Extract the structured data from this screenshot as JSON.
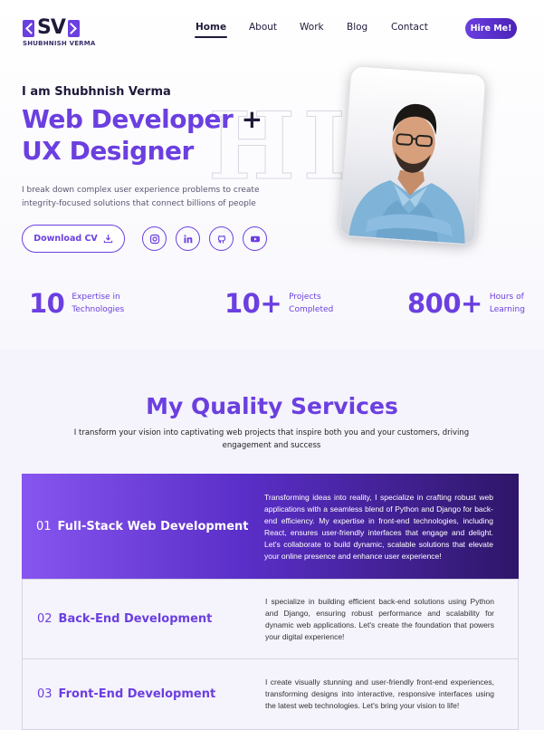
{
  "brand": {
    "logo_text": "SV",
    "name": "SHUBHNISH VERMA"
  },
  "nav": {
    "items": [
      "Home",
      "About",
      "Work",
      "Blog",
      "Contact"
    ],
    "active": "Home",
    "cta": "Hire Me!"
  },
  "hero": {
    "greeting": "I am Shubhnish Verma",
    "headline_line1": "Web Developer",
    "headline_plus": " +",
    "headline_line2": "UX Designer",
    "watermark": "HI",
    "intro": "I break down complex user experience problems to create integrity-focused solutions that connect billions of people",
    "download_label": "Download CV",
    "socials": [
      "instagram-icon",
      "linkedin-icon",
      "github-icon",
      "youtube-icon"
    ]
  },
  "stats": [
    {
      "value": "10",
      "label_line1": "Expertise in",
      "label_line2": "Technologies"
    },
    {
      "value": "10+",
      "label_line1": "Projects",
      "label_line2": "Completed"
    },
    {
      "value": "800+",
      "label_line1": "Hours of",
      "label_line2": "Learning"
    }
  ],
  "services": {
    "title": "My Quality Services",
    "subtitle": "I transform your vision into captivating web projects that inspire both you and your customers, driving engagement and success",
    "items": [
      {
        "number": "01",
        "title": "Full-Stack Web Development",
        "description": "Transforming ideas into reality, I specialize in crafting robust web applications with a seamless blend of Python and Django for back-end efficiency. My expertise in front-end technologies, including React, ensures user-friendly interfaces that engage and delight. Let's collaborate to build dynamic, scalable solutions that elevate your online presence and enhance user experience!"
      },
      {
        "number": "02",
        "title": "Back-End Development",
        "description": "I specialize in building efficient back-end solutions using Python and Django, ensuring robust performance and scalability for dynamic web applications. Let's create the foundation that powers your digital experience!"
      },
      {
        "number": "03",
        "title": "Front-End Development",
        "description": "I create visually stunning and user-friendly front-end experiences, transforming designs into interactive, responsive interfaces using the latest web technologies. Let's bring your vision to life!"
      }
    ]
  },
  "colors": {
    "accent": "#6b3fe0",
    "dark": "#1e1a3a",
    "section_bg": "#f5f3fb"
  }
}
